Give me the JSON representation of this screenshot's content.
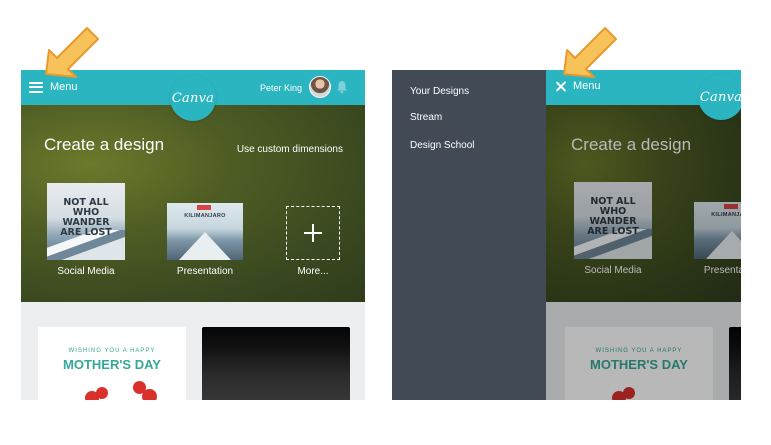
{
  "colors": {
    "brand_teal": "#2ab5c1",
    "side_menu_bg": "#414a55",
    "page_bg": "#eceef0",
    "arrow_fill": "#f8c25a",
    "arrow_stroke": "#e89a2e",
    "card_text": "#35a89a"
  },
  "header": {
    "menu_label": "Menu",
    "logo_text": "Canva",
    "user_name": "Peter King",
    "menu_icon": "hamburger-icon",
    "close_icon": "close-icon",
    "notification_icon": "bell-icon"
  },
  "hero": {
    "title": "Create a design",
    "custom_dimensions": "Use custom dimensions"
  },
  "templates": [
    {
      "label": "Social Media",
      "image_text": "NOT ALL WHO WANDER ARE LOST"
    },
    {
      "label": "Presentation",
      "image_text": "KILIMANJARO"
    },
    {
      "label": "More...",
      "icon": "plus-icon"
    }
  ],
  "cards": {
    "mothers_day_small": "WISHING YOU A HAPPY",
    "mothers_day_big": "MOTHER'S DAY"
  },
  "side_menu": {
    "items": [
      {
        "label": "Your Designs"
      },
      {
        "label": "Stream"
      },
      {
        "label": "Design School"
      }
    ]
  }
}
